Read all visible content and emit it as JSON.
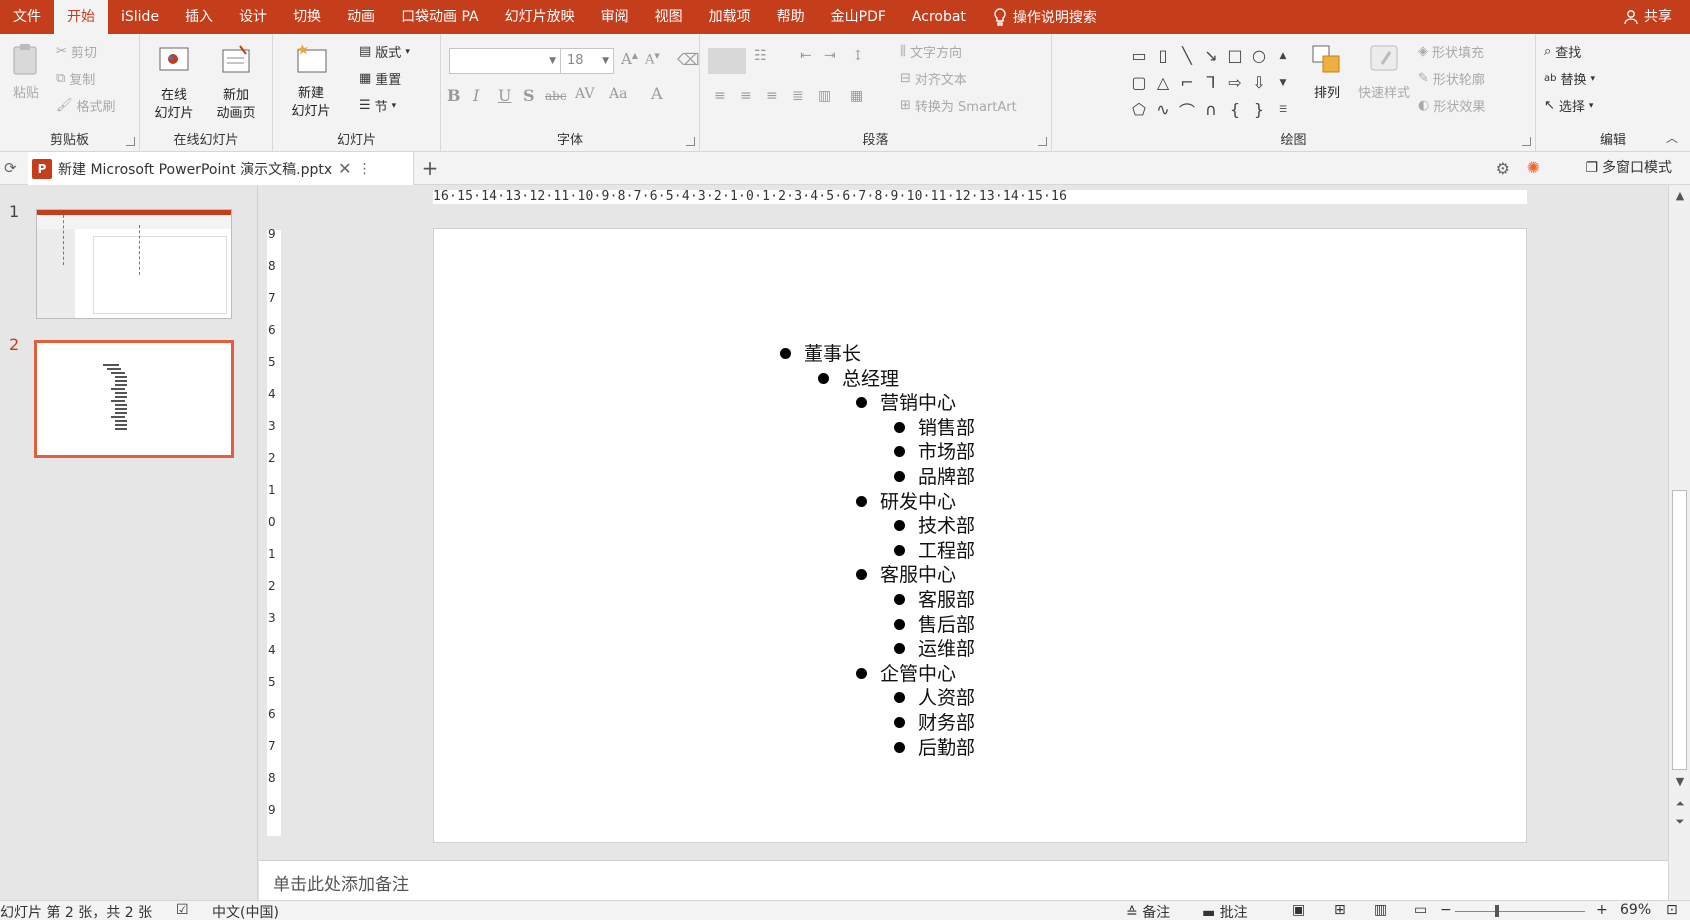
{
  "colors": {
    "accent": "#c43e1c",
    "selection": "#e0603e"
  },
  "menu": {
    "tabs": [
      "文件",
      "开始",
      "iSlide",
      "插入",
      "设计",
      "切换",
      "动画",
      "口袋动画 PA",
      "幻灯片放映",
      "审阅",
      "视图",
      "加载项",
      "帮助",
      "金山PDF",
      "Acrobat"
    ],
    "active_index": 1,
    "tell_me": "操作说明搜索",
    "share": "共享"
  },
  "ribbon": {
    "clipboard": {
      "label": "剪贴板",
      "paste": "粘贴",
      "cut": "剪切",
      "copy": "复制",
      "format_painter": "格式刷"
    },
    "online_slides": {
      "label": "在线幻灯片",
      "online_line1": "在线",
      "online_line2": "幻灯片",
      "new_anim_line1": "新加",
      "new_anim_line2": "动画页"
    },
    "slides": {
      "label": "幻灯片",
      "new_line1": "新建",
      "new_line2": "幻灯片",
      "layout": "版式",
      "reset": "重置",
      "section": "节"
    },
    "font": {
      "label": "字体",
      "font_name": "",
      "font_size": "18"
    },
    "paragraph": {
      "label": "段落",
      "text_direction": "文字方向",
      "align_text": "对齐文本",
      "smartart": "转换为 SmartArt"
    },
    "drawing": {
      "label": "绘图",
      "arrange": "排列",
      "quick_styles": "快速样式",
      "shape_fill": "形状填充",
      "shape_outline": "形状轮廓",
      "shape_effects": "形状效果"
    },
    "editing": {
      "label": "编辑",
      "find": "查找",
      "replace": "替换",
      "select": "选择"
    }
  },
  "document": {
    "tab_title": "新建 Microsoft PowerPoint 演示文稿.pptx",
    "multi_window": "多窗口模式"
  },
  "thumbnails": {
    "numbers": [
      "1",
      "2"
    ],
    "selected": 2
  },
  "ruler": {
    "horizontal": "16·15·14·13·12·11·10·9·8·7·6·5·4·3·2·1·0·1·2·3·4·5·6·7·8·9·10·11·12·13·14·15·16",
    "vertical": [
      "9",
      "8",
      "7",
      "6",
      "5",
      "4",
      "3",
      "2",
      "1",
      "0",
      "1",
      "2",
      "3",
      "4",
      "5",
      "6",
      "7",
      "8",
      "9"
    ]
  },
  "slide": {
    "outline": [
      {
        "text": "董事长",
        "level": 0
      },
      {
        "text": "总经理",
        "level": 1
      },
      {
        "text": "营销中心",
        "level": 2
      },
      {
        "text": "销售部",
        "level": 3
      },
      {
        "text": "市场部",
        "level": 3
      },
      {
        "text": "品牌部",
        "level": 3
      },
      {
        "text": "研发中心",
        "level": 2
      },
      {
        "text": "技术部",
        "level": 3
      },
      {
        "text": "工程部",
        "level": 3
      },
      {
        "text": "客服中心",
        "level": 2
      },
      {
        "text": "客服部",
        "level": 3
      },
      {
        "text": "售后部",
        "level": 3
      },
      {
        "text": "运维部",
        "level": 3
      },
      {
        "text": "企管中心",
        "level": 2
      },
      {
        "text": "人资部",
        "level": 3
      },
      {
        "text": "财务部",
        "level": 3
      },
      {
        "text": "后勤部",
        "level": 3
      }
    ]
  },
  "notes": {
    "placeholder": "单击此处添加备注"
  },
  "status": {
    "slide_info": "幻灯片 第 2 张，共 2 张",
    "language": "中文(中国)",
    "notes": "备注",
    "comments": "批注",
    "zoom": "69%"
  }
}
